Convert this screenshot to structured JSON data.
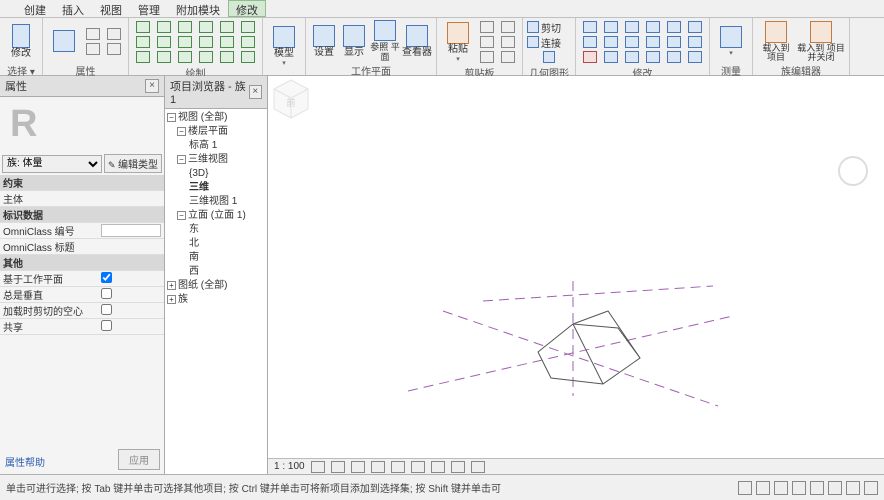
{
  "menu": {
    "items": [
      "创建",
      "插入",
      "视图",
      "管理",
      "附加模块",
      "修改"
    ],
    "active_index": 5
  },
  "ribbon": {
    "groups": [
      {
        "label": "选择 ▾",
        "large": [
          {
            "label": "修改",
            "dd": true
          }
        ]
      },
      {
        "label": "属性",
        "large": [
          {
            "label": ""
          }
        ],
        "small": [
          [
            "p1",
            "p2"
          ],
          [
            "p3",
            "p4"
          ]
        ]
      },
      {
        "label": "绘制",
        "small": [
          [
            "l1",
            "l2",
            "l3",
            "l4",
            "l5",
            "l6"
          ],
          [
            "a1",
            "a2",
            "a3",
            "a4",
            "a5",
            "a6"
          ],
          [
            "c1",
            "c2",
            "c3",
            "c4",
            "c5",
            "c6"
          ]
        ]
      },
      {
        "label": "",
        "large": [
          {
            "label": "模型",
            "dd": true
          }
        ]
      },
      {
        "label": "工作平面",
        "mixed": [
          {
            "label": "设置"
          },
          {
            "label": "显示"
          },
          {
            "label": "参照 平面"
          },
          {
            "label": "查看器"
          }
        ]
      },
      {
        "label": "剪贴板",
        "large": [
          {
            "label": "粘贴",
            "dd": true
          }
        ],
        "small": [
          [
            "x1",
            "x2"
          ],
          [
            "x3",
            "x4"
          ],
          [
            "x5",
            "x6"
          ]
        ]
      },
      {
        "label": "几何图形",
        "large": [
          {
            "label": "剪切",
            "dd": true
          },
          {
            "label": "连接",
            "dd": true
          }
        ],
        "small": [
          [
            "g1"
          ],
          [
            "g2"
          ],
          [
            "g3"
          ]
        ]
      },
      {
        "label": "修改",
        "small": [
          [
            "m1",
            "m2",
            "m3",
            "m4",
            "m5",
            "m6"
          ],
          [
            "m7",
            "m8",
            "m9",
            "ma",
            "mb",
            "mc"
          ],
          [
            "md",
            "me",
            "mf",
            "mg",
            "mh",
            "mi"
          ]
        ]
      },
      {
        "label": "测量",
        "large": [
          {
            "label": "",
            "dd": true
          }
        ]
      },
      {
        "label": "族编辑器",
        "large": [
          {
            "label": "载入到 项目"
          },
          {
            "label": "载入到 项目并关闭"
          }
        ]
      }
    ]
  },
  "properties": {
    "title": "属性",
    "family_label": "族: 体量",
    "edit_type": "编辑类型",
    "sections": {
      "constraints": {
        "header": "约束",
        "rows": [
          {
            "k": "主体",
            "v": ""
          }
        ]
      },
      "identity": {
        "header": "标识数据",
        "rows": [
          {
            "k": "OmniClass 编号",
            "input": true,
            "v": ""
          },
          {
            "k": "OmniClass 标题",
            "v": ""
          }
        ]
      },
      "other": {
        "header": "其他",
        "rows": [
          {
            "k": "基于工作平面",
            "cb": true,
            "checked": true
          },
          {
            "k": "总是垂直",
            "cb": true,
            "checked": false
          },
          {
            "k": "加载时剪切的空心",
            "cb": true,
            "checked": false
          },
          {
            "k": "共享",
            "cb": true,
            "checked": false
          }
        ]
      }
    },
    "help": "属性帮助",
    "apply": "应用"
  },
  "browser": {
    "title": "项目浏览器 - 族1",
    "tree": {
      "root": "视图 (全部)",
      "floor_plans": {
        "label": "楼层平面",
        "children": [
          "标高 1"
        ]
      },
      "three_d": {
        "label": "三维视图",
        "children": [
          "{3D}",
          "三维",
          "三维视图 1"
        ],
        "bold_index": 1
      },
      "elev": {
        "label": "立面 (立面 1)",
        "children": [
          "东",
          "北",
          "南",
          "西"
        ]
      },
      "sheets": "图纸 (全部)",
      "families": "族"
    }
  },
  "viewport": {
    "scale": "1 : 100"
  },
  "status": {
    "hint": "单击可进行选择; 按 Tab 键并单击可选择其他项目; 按 Ctrl 键并单击可将新项目添加到选择集; 按 Shift 键并单击可"
  },
  "cube": {
    "front": "前"
  }
}
